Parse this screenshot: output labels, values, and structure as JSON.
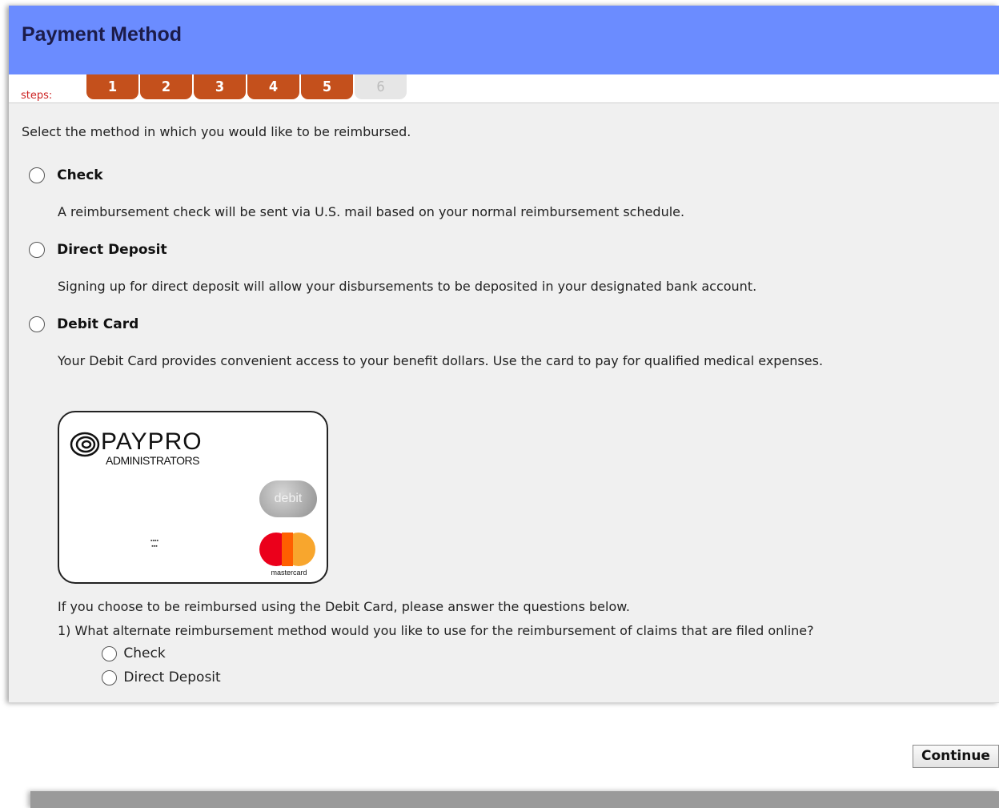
{
  "header": {
    "title": "Payment Method"
  },
  "steps": {
    "label": "steps:",
    "items": [
      "1",
      "2",
      "3",
      "4",
      "5",
      "6"
    ],
    "active_color": "#c4501c",
    "inactive_color": "#e6e6e6"
  },
  "intro": "Select the method in which you would like to be reimbursed.",
  "options": [
    {
      "label": "Check",
      "description": "A reimbursement check will be sent via U.S. mail based on your normal reimbursement schedule."
    },
    {
      "label": "Direct Deposit",
      "description": "Signing up for direct deposit will allow your disbursements to be deposited in your designated bank account."
    },
    {
      "label": "Debit Card",
      "description": "Your Debit Card provides convenient access to your benefit dollars. Use the card to pay for qualified medical expenses."
    }
  ],
  "card": {
    "brand": "PAYPRO",
    "sub": "ADMINISTRATORS",
    "debit_label": "debit",
    "network": "mastercard"
  },
  "questions": {
    "intro": "If you choose to be reimbursed using the Debit Card, please answer the questions below.",
    "q1": "1) What alternate reimbursement method would you like to use for the reimbursement of claims that are filed online?",
    "q1_options": [
      "Check",
      "Direct Deposit"
    ]
  },
  "actions": {
    "continue_label": "Continue"
  },
  "colors": {
    "header_bg": "#6b8cff",
    "panel_bg": "#f0f0f0",
    "steps_label": "#cc2222"
  }
}
